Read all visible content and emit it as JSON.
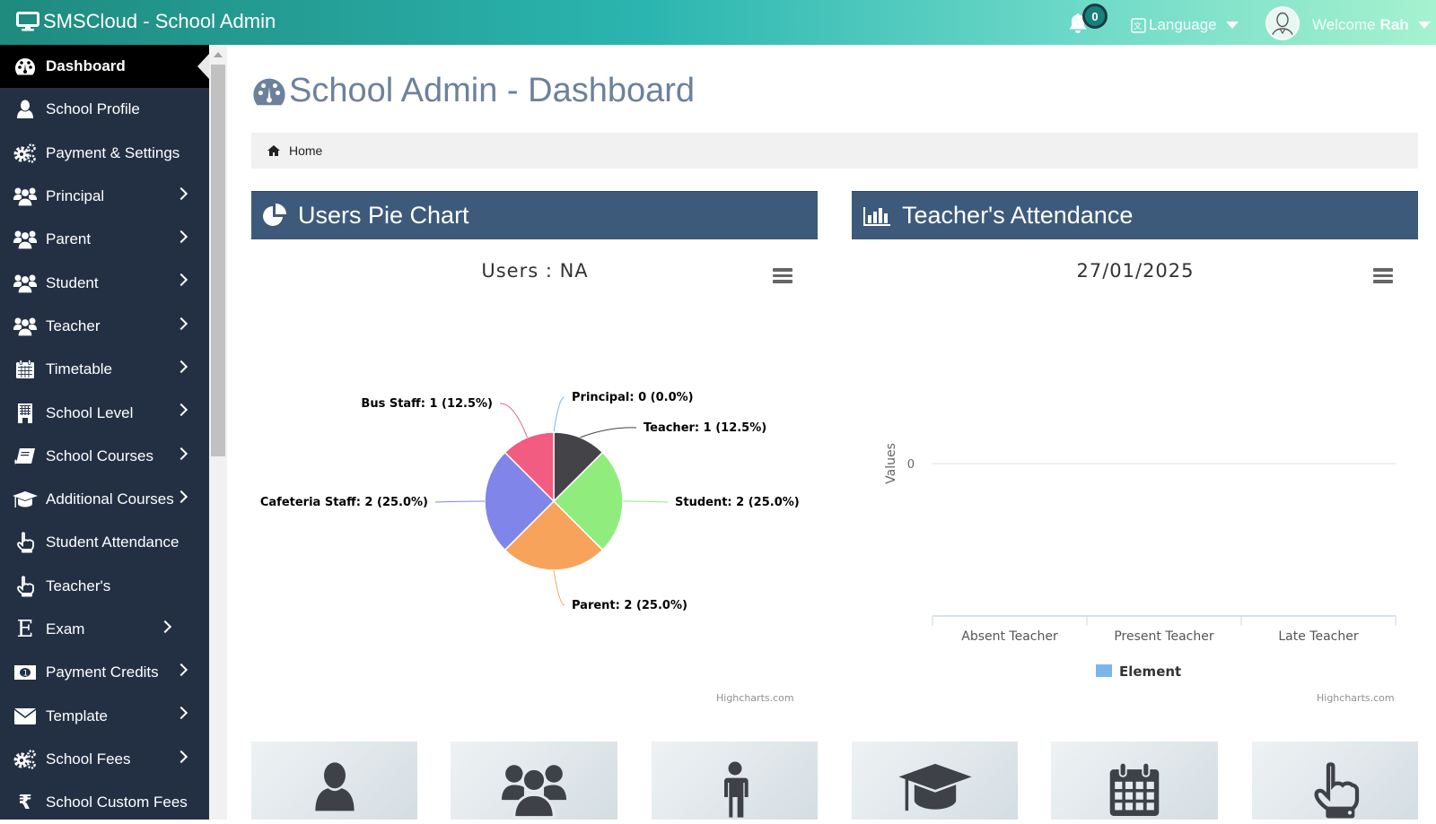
{
  "topbar": {
    "app_title": "SMSCloud - School Admin",
    "notification_count": "0",
    "language_label": "Language",
    "welcome_prefix": "Welcome",
    "welcome_name": "Rah"
  },
  "sidebar": {
    "items": [
      {
        "label": "Dashboard",
        "icon": "dashboard-icon",
        "submenu": false,
        "active": true
      },
      {
        "label": "School Profile",
        "icon": "user-icon",
        "submenu": false
      },
      {
        "label": "Payment & Settings",
        "icon": "gears-icon",
        "submenu": false
      },
      {
        "label": "Principal",
        "icon": "users-icon",
        "submenu": true
      },
      {
        "label": "Parent",
        "icon": "users-icon",
        "submenu": true
      },
      {
        "label": "Student",
        "icon": "users-icon",
        "submenu": true
      },
      {
        "label": "Teacher",
        "icon": "users-icon",
        "submenu": true
      },
      {
        "label": "Timetable",
        "icon": "calendar-icon",
        "submenu": true
      },
      {
        "label": "School Level",
        "icon": "building-icon",
        "submenu": true
      },
      {
        "label": "School Courses",
        "icon": "book-icon",
        "submenu": true
      },
      {
        "label": "Additional Courses",
        "icon": "graduation-cap-icon",
        "submenu": true
      },
      {
        "label": "Student Attendance",
        "icon": "hand-pointer-icon",
        "submenu": false
      },
      {
        "label": "Teacher's",
        "icon": "hand-pointer-icon",
        "submenu": false
      },
      {
        "label": "Exam",
        "icon": "exam-e-icon",
        "submenu": true
      },
      {
        "label": "Payment Credits",
        "icon": "money-icon",
        "submenu": true
      },
      {
        "label": "Template",
        "icon": "envelope-icon",
        "submenu": true
      },
      {
        "label": "School Fees",
        "icon": "gears-icon",
        "submenu": true
      },
      {
        "label": "School Custom Fees",
        "icon": "rupee-icon",
        "submenu": false
      }
    ]
  },
  "main": {
    "page_title": "School Admin - Dashboard",
    "breadcrumb_home": "Home",
    "panels": {
      "pie": {
        "heading": "Users Pie Chart"
      },
      "attendance": {
        "heading": "Teacher's Attendance"
      }
    },
    "credits": "Highcharts.com",
    "tiles": [
      "user-icon",
      "users-icon",
      "male-icon",
      "graduation-cap-icon",
      "calendar-icon",
      "hand-pointer-icon"
    ]
  },
  "chart_data": [
    {
      "type": "pie",
      "title": "Users : NA",
      "slices": [
        {
          "name": "Principal",
          "value": 0,
          "percent": 0.0,
          "label": "Principal: 0 (0.0%)",
          "color": "#7cb5ec"
        },
        {
          "name": "Teacher",
          "value": 1,
          "percent": 12.5,
          "label": "Teacher: 1 (12.5%)",
          "color": "#434348"
        },
        {
          "name": "Student",
          "value": 2,
          "percent": 25.0,
          "label": "Student: 2 (25.0%)",
          "color": "#90ed7d"
        },
        {
          "name": "Parent",
          "value": 2,
          "percent": 25.0,
          "label": "Parent: 2 (25.0%)",
          "color": "#f7a35c"
        },
        {
          "name": "Cafeteria Staff",
          "value": 2,
          "percent": 25.0,
          "label": "Cafeteria Staff: 2 (25.0%)",
          "color": "#8085e9"
        },
        {
          "name": "Bus Staff",
          "value": 1,
          "percent": 12.5,
          "label": "Bus Staff: 1 (12.5%)",
          "color": "#f15c80"
        }
      ]
    },
    {
      "type": "bar",
      "title": "27/01/2025",
      "categories": [
        "Absent Teacher",
        "Present Teacher",
        "Late Teacher"
      ],
      "series": [
        {
          "name": "Element",
          "values": [
            0,
            0,
            0
          ],
          "color": "#7cb5ec"
        }
      ],
      "ylabel": "Values",
      "yticks": [
        "0"
      ],
      "legend": "bottom-center"
    }
  ]
}
